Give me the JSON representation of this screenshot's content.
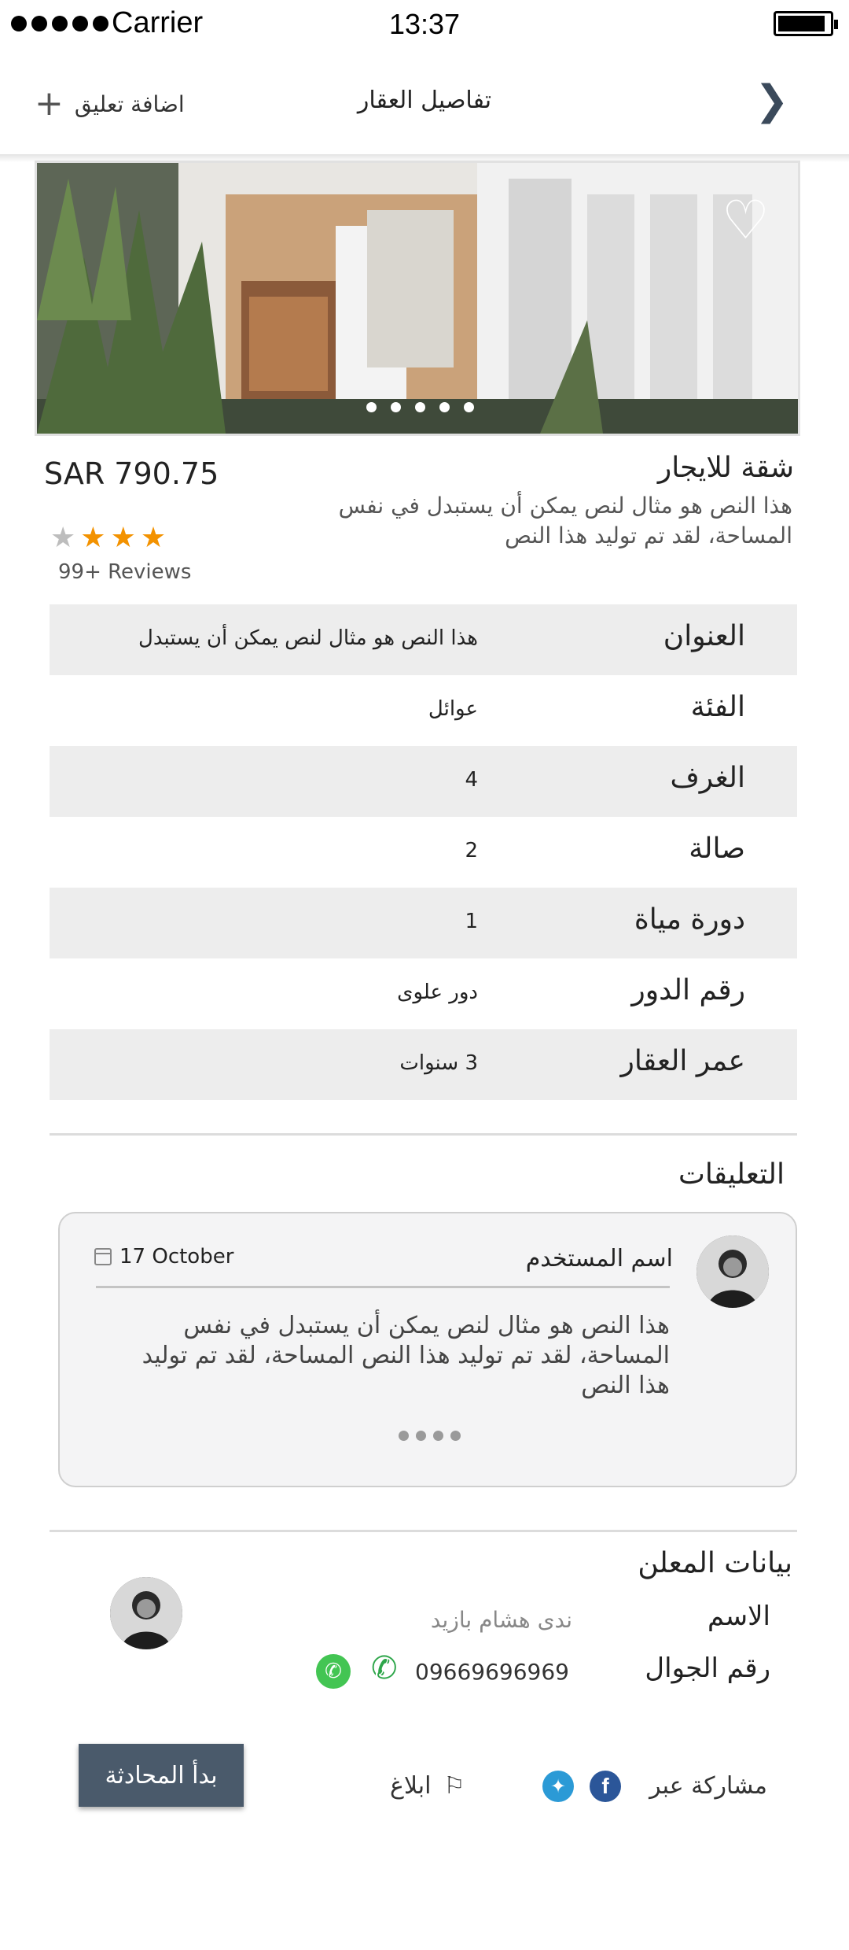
{
  "status_bar": {
    "carrier": "Carrier",
    "time": "13:37"
  },
  "nav": {
    "title": "تفاصيل العقار",
    "add_comment": "اضافة تعليق",
    "back_icon": "chevron-right-icon",
    "add_icon": "plus-icon"
  },
  "hero": {
    "favorite_icon": "heart-icon",
    "pages": 5,
    "active_page": 5
  },
  "property": {
    "price": "SAR  790.75",
    "title": "شقة للايجار",
    "description": "هذا النص هو مثال لنص يمكن أن يستبدل في نفس المساحة، لقد تم توليد هذا النص",
    "rating": 3,
    "rating_max": 4,
    "reviews": "99+ Reviews"
  },
  "details": [
    {
      "label": "العنوان",
      "value": "هذا النص هو مثال لنص يمكن أن يستبدل"
    },
    {
      "label": "الفئة",
      "value": "عوائل"
    },
    {
      "label": "الغرف",
      "value": "4"
    },
    {
      "label": "صالة",
      "value": "2"
    },
    {
      "label": "دورة مياة",
      "value": "1"
    },
    {
      "label": "رقم الدور",
      "value": "دور علوى"
    },
    {
      "label": "عمر العقار",
      "value": "3    سنوات"
    }
  ],
  "comments": {
    "title": "التعليقات",
    "item": {
      "user": "اسم المستخدم",
      "date": "17 October",
      "text": "هذا النص هو مثال لنص يمكن أن يستبدل في نفس المساحة، لقد تم توليد هذا النص  المساحة، لقد تم توليد هذا النص"
    }
  },
  "advertiser": {
    "title": "بيانات المعلن",
    "name_label": "الاسم",
    "name": "ندى هشام بازيد",
    "phone_label": "رقم الجوال",
    "phone": "09669696969"
  },
  "footer": {
    "share_label": "مشاركة عبر",
    "report": "ابلاغ",
    "start_chat": "بدأ المحادثة"
  },
  "colors": {
    "accent": "#4a5a6b",
    "star": "#f39200",
    "whatsapp": "#43c553",
    "facebook": "#2b5699",
    "twitter": "#2b9ad6"
  }
}
